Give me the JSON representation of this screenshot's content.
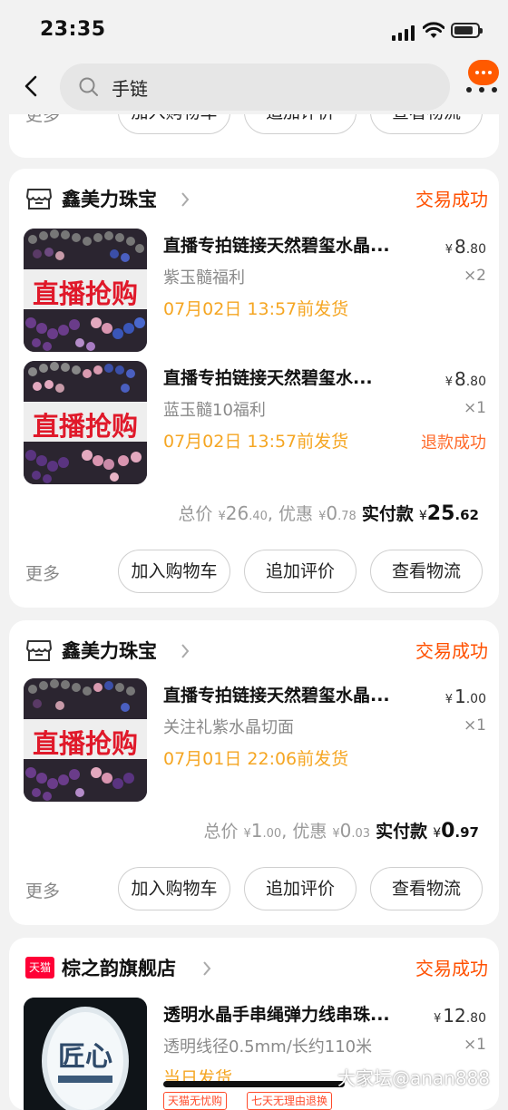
{
  "status_bar": {
    "time": "23:35"
  },
  "nav": {
    "search_query": "手链"
  },
  "top_partial_card": {
    "more": "更多",
    "buttons": [
      "加入购物车",
      "追加评价",
      "查看物流"
    ]
  },
  "orders": [
    {
      "shop": "鑫美力珠宝",
      "status": "交易成功",
      "items": [
        {
          "thumb_text": "直播抢购",
          "title": "直播专拍链接天然碧玺水晶...",
          "price_int": "8",
          "price_dec": ".80",
          "spec": "紫玉髓福利",
          "qty": "×2",
          "ship": "07月02日 13:57前发货",
          "refund": ""
        },
        {
          "thumb_text": "直播抢购",
          "title": "直播专拍链接天然碧玺水...",
          "price_int": "8",
          "price_dec": ".80",
          "spec": "蓝玉髓10福利",
          "qty": "×1",
          "ship": "07月02日 13:57前发货",
          "refund": "退款成功"
        }
      ],
      "total_label": "总价",
      "total_int": "26",
      "total_dec": ".40",
      "discount_label": "优惠",
      "discount_int": "0",
      "discount_dec": ".78",
      "paid_label": "实付款",
      "paid_int": "25",
      "paid_dec": ".62",
      "more": "更多",
      "buttons": [
        "加入购物车",
        "追加评价",
        "查看物流"
      ]
    },
    {
      "shop": "鑫美力珠宝",
      "status": "交易成功",
      "items": [
        {
          "thumb_text": "直播抢购",
          "title": "直播专拍链接天然碧玺水晶...",
          "price_int": "1",
          "price_dec": ".00",
          "spec": "关注礼紫水晶切面",
          "qty": "×1",
          "ship": "07月01日 22:06前发货",
          "refund": ""
        }
      ],
      "total_label": "总价",
      "total_int": "1",
      "total_dec": ".00",
      "discount_label": "优惠",
      "discount_int": "0",
      "discount_dec": ".03",
      "paid_label": "实付款",
      "paid_int": "0",
      "paid_dec": ".97",
      "more": "更多",
      "buttons": [
        "加入购物车",
        "追加评价",
        "查看物流"
      ]
    },
    {
      "shop": "棕之韵旗舰店",
      "shop_badge": "天猫",
      "status": "交易成功",
      "items": [
        {
          "thumb_text": "匠心",
          "title": "透明水晶手串绳弹力线串珠...",
          "price_int": "12",
          "price_dec": ".80",
          "spec": "透明线径0.5mm/长约110米",
          "qty": "×1",
          "ship": "当日发货",
          "refund": ""
        }
      ],
      "promos": [
        "天猫无忧购",
        "七天无理由退换"
      ]
    }
  ],
  "currency": "¥",
  "watermark": "大家坛@anan888",
  "colors": {
    "accent": "#ff5000",
    "ship": "#f5a623",
    "tmall": "#ff0036"
  }
}
